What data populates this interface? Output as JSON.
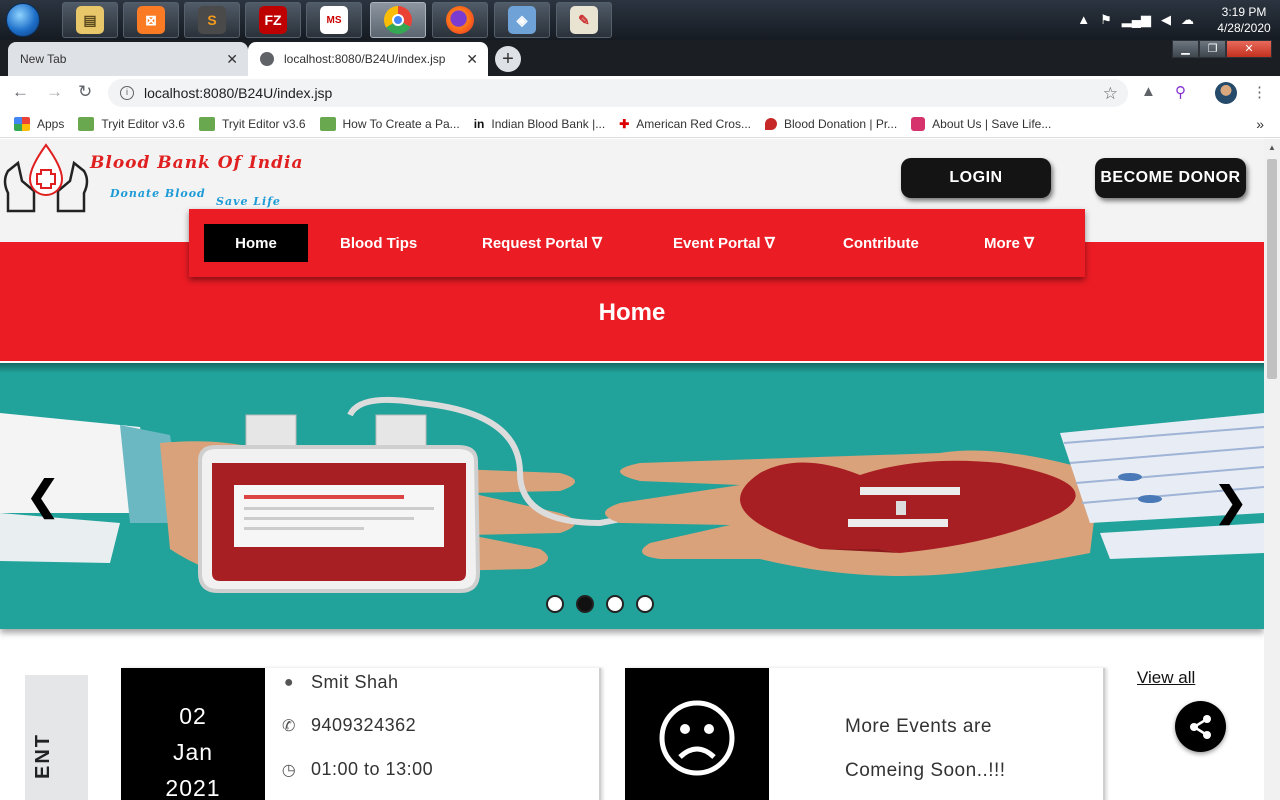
{
  "taskbar": {
    "apps": [
      "file-explorer",
      "xampp",
      "sublime-text",
      "filezilla",
      "ms-tools",
      "chrome",
      "firefox",
      "virtualbox",
      "paint"
    ],
    "clock": {
      "time": "3:19 PM",
      "date": "4/28/2020"
    }
  },
  "browser": {
    "tabs": [
      {
        "title": "New Tab"
      },
      {
        "title": "localhost:8080/B24U/index.jsp"
      }
    ],
    "address": "localhost:8080/B24U/index.jsp",
    "bookmarks": [
      {
        "label": "Apps",
        "icon": "apps-grid-icon"
      },
      {
        "label": "Tryit Editor v3.6",
        "icon": "w3-icon"
      },
      {
        "label": "Tryit Editor v3.6",
        "icon": "w3-icon"
      },
      {
        "label": "How To Create a Pa...",
        "icon": "w3-icon"
      },
      {
        "label": "Indian Blood Bank |...",
        "icon": "in-icon",
        "glyph": "in"
      },
      {
        "label": "American Red Cros...",
        "icon": "red-cross-icon",
        "glyph": "✚"
      },
      {
        "label": "Blood Donation | Pr...",
        "icon": "blood-drop-icon"
      },
      {
        "label": "About Us | Save Life...",
        "icon": "heart-icon"
      }
    ],
    "bookmarks_more": "»"
  },
  "site": {
    "logo_title": "Blood Bank Of India",
    "logo_tag1": "Donate Blood",
    "logo_tag2": "Save Life",
    "login_label": "LOGIN",
    "donor_label": "BECOME DONOR",
    "nav": [
      {
        "label": "Home"
      },
      {
        "label": "Blood Tips"
      },
      {
        "label": "Request Portal ∇"
      },
      {
        "label": "Event Portal ∇"
      },
      {
        "label": "Contribute"
      },
      {
        "label": "More ∇"
      }
    ],
    "heading": "Home",
    "carousel": {
      "prev": "❮",
      "next": "❯",
      "slide_count": 4,
      "active_slide": 2
    },
    "events_side_label": "ENT",
    "event": {
      "day": "02",
      "month": "Jan",
      "year": "2021",
      "name": "Smit Shah",
      "phone": "9409324362",
      "time": "01:00 to 13:00"
    },
    "coming_soon": {
      "line1": "More Events are",
      "line2": "Comeing Soon..!!!"
    },
    "view_all": "View all"
  },
  "colors": {
    "brand_red": "#ec1c24",
    "carousel_teal": "#21a29a",
    "button_black": "#141414"
  }
}
